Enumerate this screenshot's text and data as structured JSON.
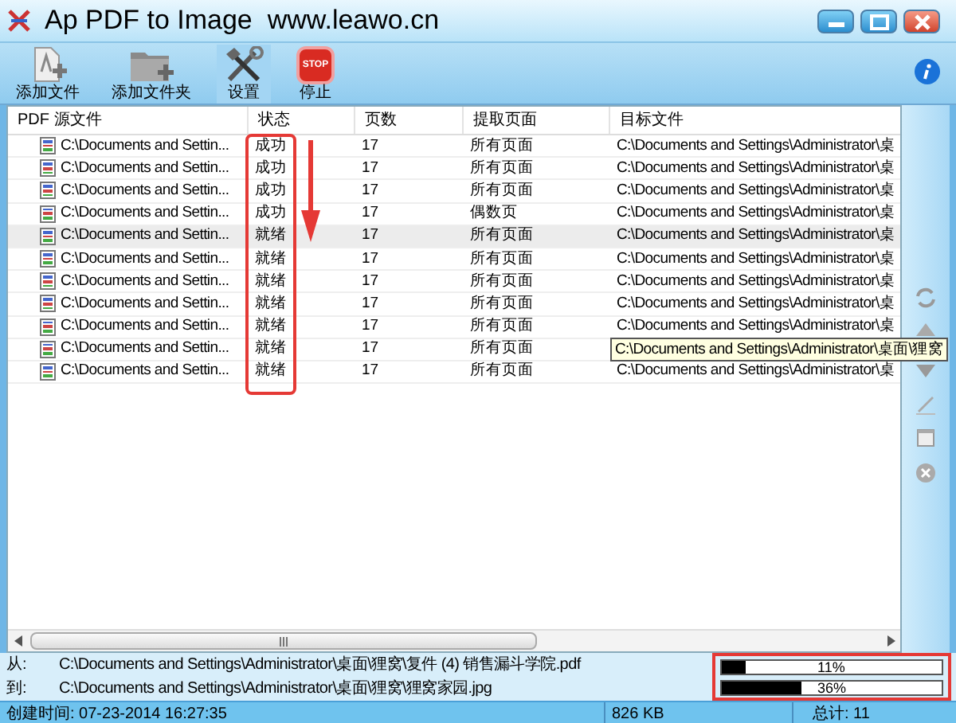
{
  "window": {
    "title": "Ap PDF to Image  www.leawo.cn"
  },
  "toolbar": [
    {
      "label": "添加文件",
      "kind": "file",
      "pressed": false
    },
    {
      "label": "添加文件夹",
      "kind": "folder",
      "pressed": false
    },
    {
      "label": "设置",
      "kind": "settings",
      "pressed": true
    },
    {
      "label": "停止",
      "kind": "stop",
      "pressed": false,
      "icon_text": "STOP"
    }
  ],
  "table": {
    "columns": [
      "PDF 源文件",
      "状态",
      "页数",
      "提取页面",
      "目标文件"
    ],
    "rows": [
      {
        "cells": [
          "C:\\Documents and Settin...",
          "成功",
          "17",
          "所有页面",
          "C:\\Documents and Settings\\Administrator\\桌"
        ],
        "selected": false
      },
      {
        "cells": [
          "C:\\Documents and Settin...",
          "成功",
          "17",
          "所有页面",
          "C:\\Documents and Settings\\Administrator\\桌"
        ],
        "selected": false
      },
      {
        "cells": [
          "C:\\Documents and Settin...",
          "成功",
          "17",
          "所有页面",
          "C:\\Documents and Settings\\Administrator\\桌"
        ],
        "selected": false
      },
      {
        "cells": [
          "C:\\Documents and Settin...",
          "成功",
          "17",
          "偶数页",
          "C:\\Documents and Settings\\Administrator\\桌"
        ],
        "selected": false
      },
      {
        "cells": [
          "C:\\Documents and Settin...",
          "就绪",
          "17",
          "所有页面",
          "C:\\Documents and Settings\\Administrator\\桌"
        ],
        "selected": true
      },
      {
        "cells": [
          "C:\\Documents and Settin...",
          "就绪",
          "17",
          "所有页面",
          "C:\\Documents and Settings\\Administrator\\桌"
        ],
        "selected": false
      },
      {
        "cells": [
          "C:\\Documents and Settin...",
          "就绪",
          "17",
          "所有页面",
          "C:\\Documents and Settings\\Administrator\\桌"
        ],
        "selected": false
      },
      {
        "cells": [
          "C:\\Documents and Settin...",
          "就绪",
          "17",
          "所有页面",
          "C:\\Documents and Settings\\Administrator\\桌"
        ],
        "selected": false
      },
      {
        "cells": [
          "C:\\Documents and Settin...",
          "就绪",
          "17",
          "所有页面",
          "C:\\Documents and Settings\\Administrator\\桌"
        ],
        "selected": false
      },
      {
        "cells": [
          "C:\\Documents and Settin...",
          "就绪",
          "17",
          "所有页面"
        ],
        "selected": false
      },
      {
        "cells": [
          "C:\\Documents and Settin...",
          "就绪",
          "17",
          "所有页面",
          "C:\\Documents and Settings\\Administrator\\桌"
        ],
        "selected": false
      }
    ],
    "tooltip": "C:\\Documents and Settings\\Administrator\\桌面\\狸窝"
  },
  "transfer": [
    {
      "label": "从:",
      "path": "C:\\Documents and Settings\\Administrator\\桌面\\狸窝\\复件 (4) 销售漏斗学院.pdf",
      "level": 0.11,
      "reading": "11%"
    },
    {
      "label": "到:",
      "path": "C:\\Documents and Settings\\Administrator\\桌面\\狸窝\\狸窝家园.jpg",
      "level": 0.36,
      "reading": "36%"
    }
  ],
  "status_bar": {
    "created": "创建时间: 07-23-2014 16:27:35",
    "size": "826 KB",
    "total": "总计: 11"
  }
}
